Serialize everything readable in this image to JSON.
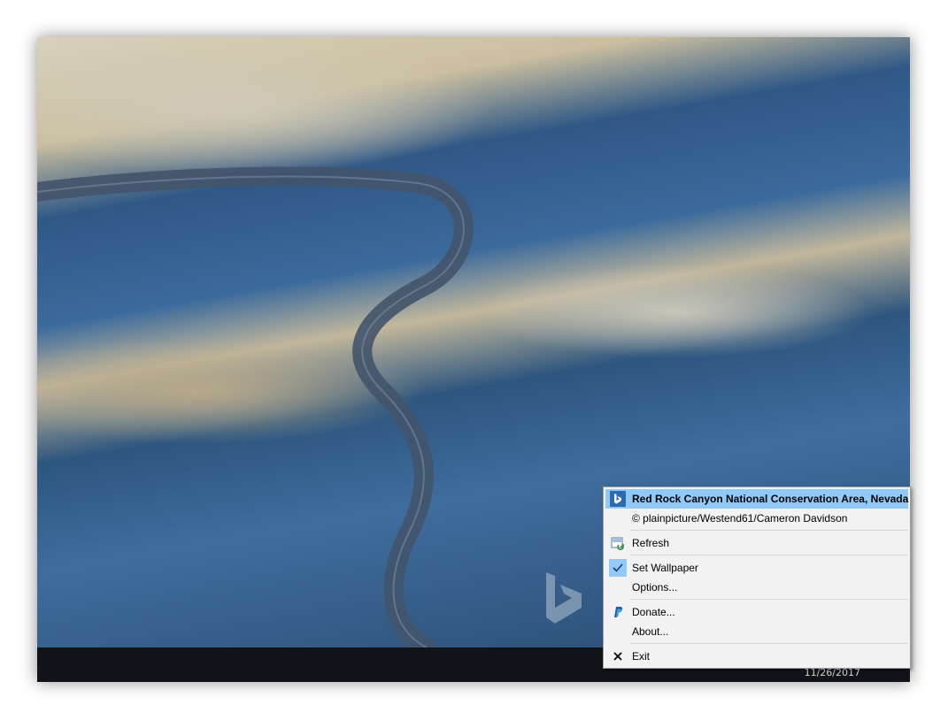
{
  "taskbar": {
    "date": "11/26/2017",
    "tray_icons": [
      "network-icon",
      "volume-icon",
      "chevron-up-icon"
    ]
  },
  "menu": {
    "items": [
      {
        "label": "Red Rock Canyon National Conservation Area, Nevada",
        "icon": "bing-icon",
        "highlighted": true
      },
      {
        "label": "© plainpicture/Westend61/Cameron Davidson",
        "icon": ""
      },
      {
        "label": "Refresh",
        "icon": "refresh-icon"
      },
      {
        "label": "Set Wallpaper",
        "icon": "checkmark-icon",
        "checked": true
      },
      {
        "label": "Options...",
        "icon": ""
      },
      {
        "label": "Donate...",
        "icon": "paypal-icon"
      },
      {
        "label": "About...",
        "icon": ""
      },
      {
        "label": "Exit",
        "icon": "close-icon"
      }
    ]
  },
  "colors": {
    "menu_highlight": "#91c9f7",
    "menu_background": "#f2f2f2",
    "taskbar": "#101419",
    "bing_blue": "#2b6cb0",
    "paypal_blue": "#1f5fa8"
  }
}
